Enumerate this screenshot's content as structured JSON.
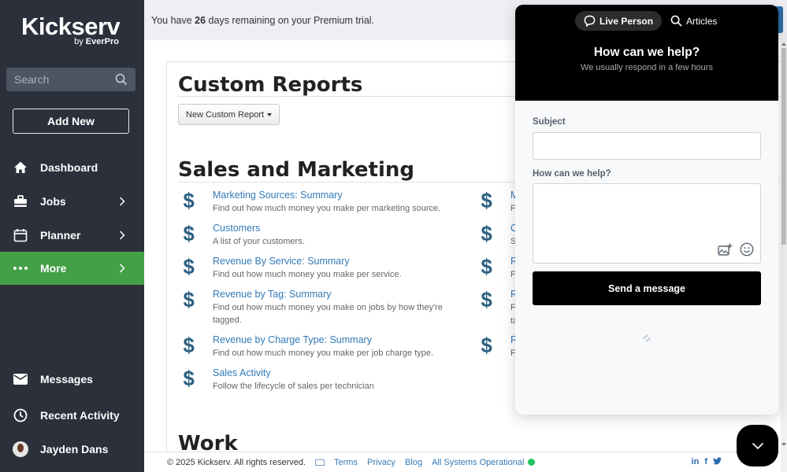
{
  "sidebar": {
    "logo": {
      "main": "Kickserv",
      "by": "by",
      "brand": "EverPro"
    },
    "search_placeholder": "Search",
    "add_new_label": "Add New",
    "nav": [
      {
        "label": "Dashboard",
        "icon": "home-icon",
        "has_chevron": false,
        "active": false
      },
      {
        "label": "Jobs",
        "icon": "briefcase-icon",
        "has_chevron": true,
        "active": false
      },
      {
        "label": "Planner",
        "icon": "calendar-icon",
        "has_chevron": true,
        "active": false
      },
      {
        "label": "More",
        "icon": "more-dots-icon",
        "has_chevron": true,
        "active": true
      }
    ],
    "bottom_nav": [
      {
        "label": "Messages",
        "icon": "envelope-icon"
      },
      {
        "label": "Recent Activity",
        "icon": "clock-icon"
      },
      {
        "label": "Jayden Dans",
        "icon": "avatar"
      }
    ],
    "colors": {
      "background": "#2b303b",
      "active": "#43a047"
    }
  },
  "trial_banner": {
    "prefix": "You have ",
    "days": "26",
    "suffix": " days remaining on your Premium trial."
  },
  "main": {
    "page_title": "Custom Reports",
    "new_report_button": "New Custom Report",
    "sections": [
      {
        "title": "Sales and Marketing",
        "left_reports": [
          {
            "title": "Marketing Sources: Summary",
            "description": "Find out how much money you make per marketing source."
          },
          {
            "title": "Customers",
            "description": "A list of your customers."
          },
          {
            "title": "Revenue By Service: Summary",
            "description": "Find out how much money you make per service."
          },
          {
            "title": "Revenue by Tag: Summary",
            "description": "Find out how much money you make on jobs by how they're tagged."
          },
          {
            "title": "Revenue by Charge Type: Summary",
            "description": "Find out how much money you make per job charge type."
          },
          {
            "title": "Sales Activity",
            "description": "Follow the lifecycle of sales per technician"
          }
        ],
        "right_reports_partial": [
          {
            "title": "M",
            "description": "Fi"
          },
          {
            "title": "Cu",
            "description": "Se"
          },
          {
            "title": "Re",
            "description": "Fi"
          },
          {
            "title": "Re",
            "description": "Fi",
            "description2": "ta"
          },
          {
            "title": "Re",
            "description": "Fi"
          }
        ]
      },
      {
        "title": "Work"
      }
    ],
    "report_icon": "dollar-icon",
    "link_color": "#337ab7",
    "icon_color": "#2b5f82"
  },
  "footer": {
    "copyright": "© 2025 Kickserv. All rights reserved.",
    "links": [
      "Terms",
      "Privacy",
      "Blog",
      "All Systems Operational"
    ],
    "status_color": "#22c55e",
    "socials": [
      "in",
      "f",
      "twitter-icon"
    ]
  },
  "chat": {
    "tabs": [
      {
        "label": "Live Person",
        "icon": "chat-bubble-icon",
        "active": true
      },
      {
        "label": "Articles",
        "icon": "search-icon",
        "active": false
      }
    ],
    "title": "How can we help?",
    "subtitle": "We usually respond in a few hours",
    "subject_label": "Subject",
    "subject_value": "",
    "message_label": "How can we help?",
    "message_value": "",
    "send_label": "Send a message"
  }
}
